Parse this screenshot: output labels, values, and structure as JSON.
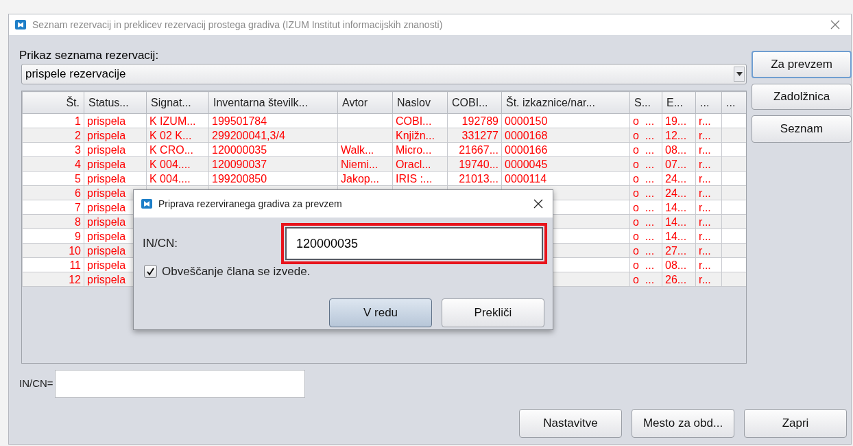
{
  "window": {
    "title": "Seznam rezervacij in preklicev rezervacij prostega gradiva (IZUM Institut informacijskih znanosti)"
  },
  "view_label": "Prikaz seznama rezervacij:",
  "view_select": {
    "value": "prispele rezervacije"
  },
  "table": {
    "columns": [
      "Št.",
      "Status...",
      "Signat...",
      "Inventarna številk...",
      "Avtor",
      "Naslov",
      "COBI...",
      "Št. izkaznice/nar...",
      "S...",
      "E...",
      "...",
      "..."
    ],
    "rows": [
      {
        "no": "1",
        "status": "prispela",
        "signature": "K IZUM...",
        "inventory": "199501784",
        "title": "COBI...",
        "cobiss": "192789",
        "card": "0000150",
        "s": "o  ...",
        "e": "19...",
        "column_11": "r..."
      },
      {
        "no": "2",
        "status": "prispela",
        "signature": "K 02 K...",
        "inventory": "299200041,3/4",
        "title": "Knjižn...",
        "cobiss": "331277",
        "card": "0000168",
        "s": "o  ...",
        "e": "12...",
        "column_11": "r..."
      },
      {
        "no": "3",
        "status": "prispela",
        "signature": "K CRO...",
        "inventory": "120000035",
        "author": "Walk...",
        "title": "Micro...",
        "cobiss": "21667...",
        "card": "0000166",
        "s": "o  ...",
        "e": "08...",
        "column_11": "r..."
      },
      {
        "no": "4",
        "status": "prispela",
        "signature": "K 004....",
        "inventory": "120090037",
        "author": "Niemi...",
        "title": "Oracl...",
        "cobiss": "19740...",
        "card": "0000045",
        "s": "o  ...",
        "e": "07...",
        "column_11": "r..."
      },
      {
        "no": "5",
        "status": "prispela",
        "signature": "K 004....",
        "inventory": "199200850",
        "author": "Jakop...",
        "title": "IRIS :...",
        "cobiss": "21013...",
        "card": "0000114",
        "s": "o  ...",
        "e": "24...",
        "column_11": "r..."
      },
      {
        "no": "6",
        "status": "prispela",
        "s": "o  ...",
        "e": "24...",
        "column_11": "r..."
      },
      {
        "no": "7",
        "status": "prispela",
        "s": "o  ...",
        "e": "14...",
        "column_11": "r..."
      },
      {
        "no": "8",
        "status": "prispela",
        "s": "o  ...",
        "e": "14...",
        "column_11": "r..."
      },
      {
        "no": "9",
        "status": "prispela",
        "s": "o  ...",
        "e": "14...",
        "column_11": "r..."
      },
      {
        "no": "10",
        "status": "prispela",
        "s": "o  ...",
        "e": "27...",
        "column_11": "r..."
      },
      {
        "no": "11",
        "status": "prispela",
        "s": "o  ...",
        "e": "08...",
        "column_11": "r..."
      },
      {
        "no": "12",
        "status": "prispela",
        "s": "o  ...",
        "e": "26...",
        "column_11": "r..."
      }
    ]
  },
  "side_buttons": [
    {
      "label": "Za prevzem",
      "focused": true
    },
    {
      "label": "Zadolžnica",
      "focused": false
    },
    {
      "label": "Seznam",
      "focused": false
    }
  ],
  "incn_label": "IN/CN=",
  "bottom_buttons": [
    "Nastavitve",
    "Mesto za obd...",
    "Zapri"
  ],
  "dialog": {
    "title": "Priprava rezerviranega gradiva za prevzem",
    "field_label": "IN/CN:",
    "field_value": "120000035",
    "notify": {
      "label": "Obveščanje člana se izvede.",
      "checked": true
    },
    "buttons": [
      {
        "label": "V redu",
        "default": true
      },
      {
        "label": "Prekliči",
        "default": false
      }
    ]
  }
}
